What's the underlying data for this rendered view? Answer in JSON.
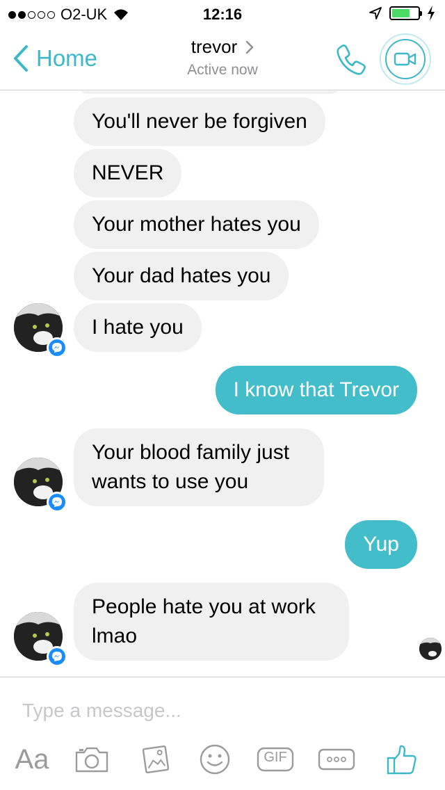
{
  "status_bar": {
    "carrier": "O2-UK",
    "time": "12:16",
    "battery_color": "#4cd964"
  },
  "nav": {
    "back_label": "Home",
    "contact_name": "trevor",
    "contact_status": "Active now",
    "accent": "#3db8c8"
  },
  "messages": [
    {
      "side": "in",
      "text": "You'll never be forgiven"
    },
    {
      "side": "in",
      "text": "NEVER"
    },
    {
      "side": "in",
      "text": "Your mother hates you"
    },
    {
      "side": "in",
      "text": "Your dad hates you"
    },
    {
      "side": "in",
      "text": "I hate you"
    },
    {
      "side": "out",
      "text": "I know that Trevor"
    },
    {
      "side": "in",
      "text": "Your blood family just wants to use you"
    },
    {
      "side": "out",
      "text": "Yup"
    },
    {
      "side": "in",
      "text": "People hate you at work lmao"
    }
  ],
  "colors": {
    "incoming_bubble": "#f0f0f0",
    "outgoing_bubble": "#42bdc9",
    "messenger_badge": "#1a8cff"
  },
  "composer": {
    "placeholder": "Type a message...",
    "text_icon_label": "Aa",
    "gif_label": "GIF",
    "icons": [
      "text-icon",
      "camera-icon",
      "gallery-icon",
      "emoji-icon",
      "gif-icon",
      "more-icon",
      "thumbs-up-icon"
    ]
  }
}
